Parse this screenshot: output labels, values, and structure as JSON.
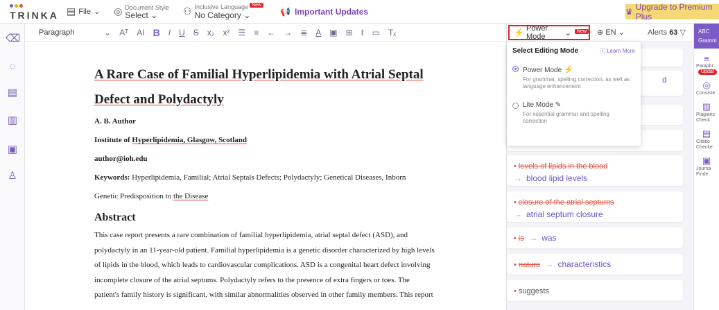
{
  "app": {
    "logo_text": "TRINKA",
    "logo_dot_colors": [
      "#7b5cc7",
      "#f0b400",
      "#e05545"
    ]
  },
  "menubar": {
    "file_label": "File",
    "doc_style_small": "Document Style",
    "doc_style_main": "Select",
    "inclusive_small": "Inclusive Language",
    "inclusive_main": "No Category",
    "new_badge": "New",
    "important_updates": "Important Updates",
    "upgrade": "Upgrade to Premium Plus"
  },
  "toolbar": {
    "paragraph": "Paragraph",
    "items": [
      "Aᵀ",
      "AI",
      "B",
      "I",
      "U",
      "S",
      "x₂",
      "x²",
      "☰",
      "≡",
      "←",
      "→",
      "≣",
      "A",
      "▣",
      "⊞",
      "ℓ",
      "▭",
      "Tₓ"
    ]
  },
  "document": {
    "title_line1": "A Rare Case of Familial Hyperlipidemia with Atrial Septal",
    "title_line2": "Defect and Polydactyly",
    "author": "A. B. Author",
    "institute_prefix": "Institute of ",
    "institute_underlined": "Hyperlipidemia, Glasgow, Scotland",
    "email": "author@ioh.edu",
    "keywords_label": "Keywords:",
    "keywords_text": " Hyperlipidemia, Familial; Atrial Septals Defects; Polydactyly; Genetical Diseases, Inborn",
    "keywords_line2_prefix": "Genetic Predisposition to ",
    "keywords_line2_underlined": "the Disease",
    "abstract_heading": "Abstract",
    "abstract_lines": [
      "This case report presents a rare combination of familial hyperlipidemia, atrial septal defect (ASD), and",
      "polydactyly in an 11-year-old patient. Familial hyperlipidemia is a genetic disorder characterized by high levels",
      "of lipids in the blood, which leads to cardiovascular complications. ASD is a congenital heart defect involving",
      "incomplete closure of the atrial septums. Polydactyly refers to the presence of extra fingers or toes. The",
      "patient's family history is significant, with similar abnormalities observed in other family members. This report"
    ]
  },
  "right_panel": {
    "power_mode": "Power Mode",
    "new_badge": "New",
    "lang": "EN",
    "alerts_label": "Alerts",
    "alerts_count": "63",
    "partial_text": "d",
    "suggestions": [
      {
        "original": "levels of lipids in the blood",
        "correction": "blood lipid levels"
      },
      {
        "original": "closure of the atrial septums",
        "correction": "atrial septum closure"
      },
      {
        "original": "is",
        "correction": "was"
      },
      {
        "original": "nature",
        "correction": "characteristics"
      },
      {
        "original": "suggests",
        "correction": ""
      }
    ]
  },
  "dropdown": {
    "title": "Select Editing Mode",
    "learn_more": "Learn More",
    "modes": [
      {
        "name": "Power Mode",
        "desc": "For grammar, spelling correction, as well as language enhancement",
        "selected": true
      },
      {
        "name": "Lite Mode",
        "desc": "For essential grammar and spelling correction",
        "selected": false
      }
    ]
  },
  "far_right": {
    "head_line1": "ABC",
    "head_line2": "Gramm",
    "items": [
      {
        "label_line1": "Paraphr",
        "label_line2": "Updat"
      },
      {
        "label_line1": "Consiste",
        "label_line2": ""
      },
      {
        "label_line1": "Plagiaris",
        "label_line2": "Check"
      },
      {
        "label_line1": "Citatio",
        "label_line2": "Checke"
      },
      {
        "label_line1": "Journa",
        "label_line2": "Finde"
      }
    ]
  }
}
